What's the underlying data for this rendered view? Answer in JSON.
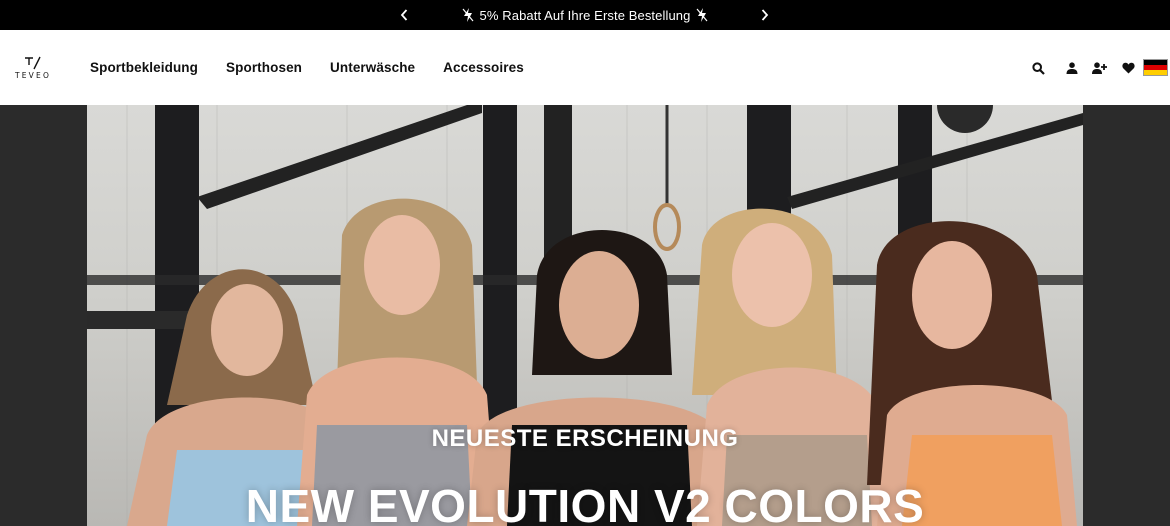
{
  "announcement": {
    "text": "5% Rabatt Auf Ihre Erste Bestellung",
    "prev_icon": "chevron-left-icon",
    "next_icon": "chevron-right-icon",
    "decor_icon": "lightning-bolt-icon"
  },
  "brand": {
    "name": "TEVEO"
  },
  "nav": {
    "items": [
      {
        "label": "Sportbekleidung"
      },
      {
        "label": "Sporthosen"
      },
      {
        "label": "Unterwäsche"
      },
      {
        "label": "Accessoires"
      }
    ]
  },
  "header_icons": [
    "search-icon",
    "account-icon",
    "add-user-icon",
    "heart-icon",
    "germany-flag-icon"
  ],
  "flag_colors": [
    "#000000",
    "#DD0000",
    "#FFCE00"
  ],
  "hero": {
    "eyebrow": "NEUESTE ERSCHEINUNG",
    "headline": "NEW EVOLUTION V2 COLORS"
  }
}
